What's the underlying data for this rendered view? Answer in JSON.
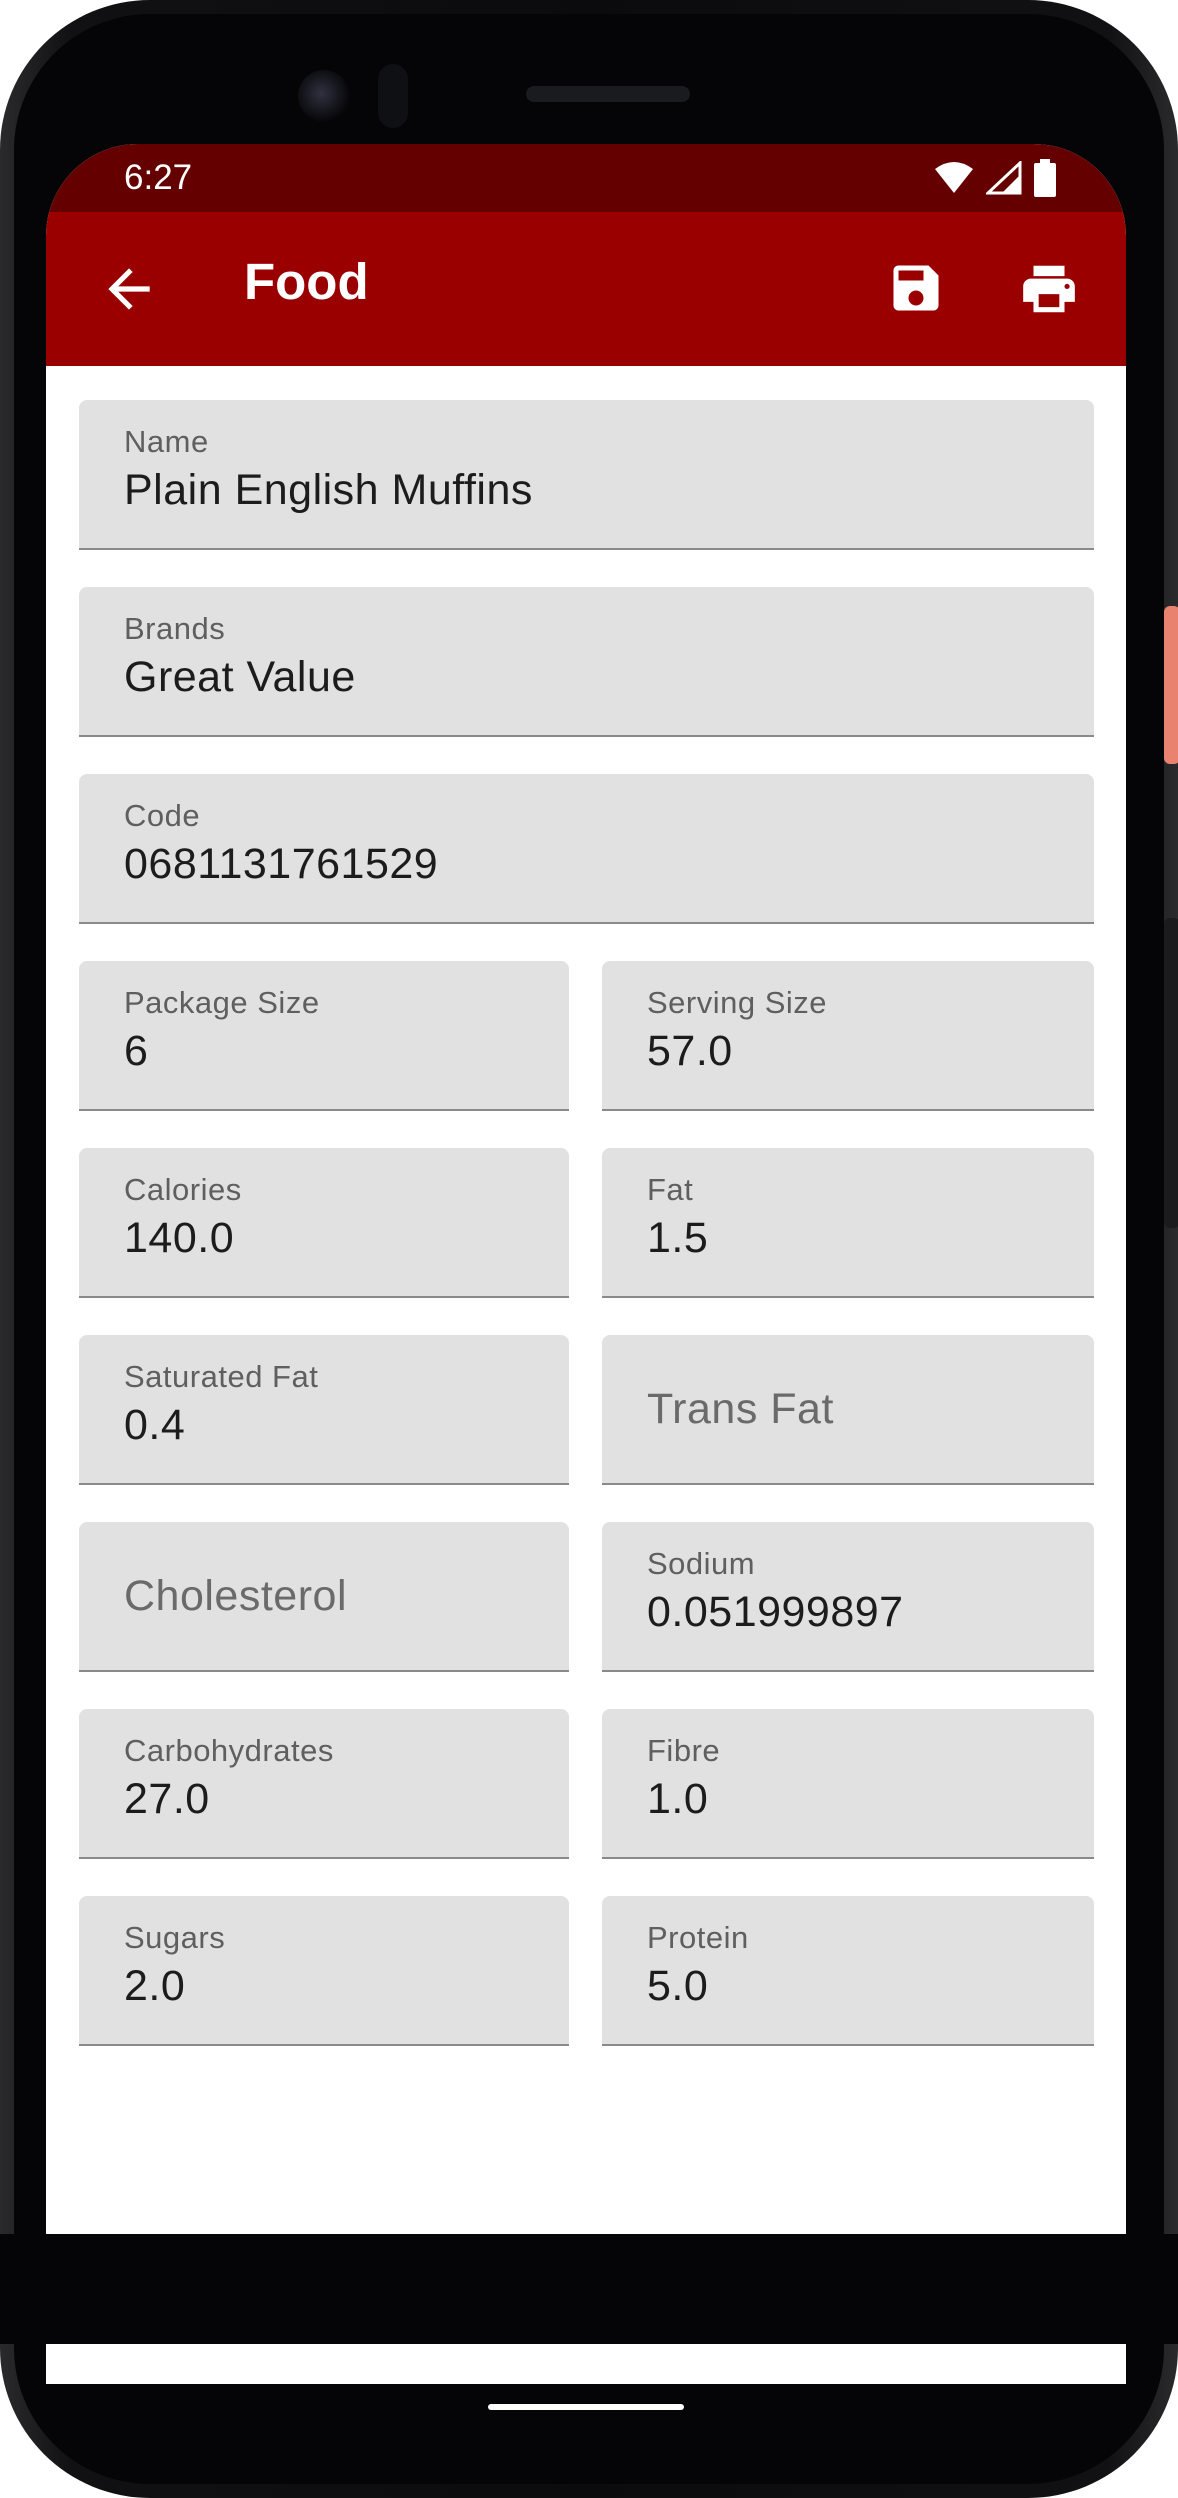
{
  "status_bar": {
    "time": "6:27"
  },
  "app_bar": {
    "title": "Food"
  },
  "fields": [
    {
      "id": "name",
      "label": "Name",
      "value": "Plain English Muffins"
    },
    {
      "id": "brands",
      "label": "Brands",
      "value": "Great Value"
    },
    {
      "id": "code",
      "label": "Code",
      "value": "0681131761529"
    },
    {
      "id": "package_size",
      "label": "Package Size",
      "value": "6"
    },
    {
      "id": "serving_size",
      "label": "Serving Size",
      "value": "57.0"
    },
    {
      "id": "calories",
      "label": "Calories",
      "value": "140.0"
    },
    {
      "id": "fat",
      "label": "Fat",
      "value": "1.5"
    },
    {
      "id": "saturated_fat",
      "label": "Saturated Fat",
      "value": "0.4"
    },
    {
      "id": "trans_fat",
      "label": "Trans Fat",
      "value": ""
    },
    {
      "id": "cholesterol",
      "label": "Cholesterol",
      "value": ""
    },
    {
      "id": "sodium",
      "label": "Sodium",
      "value": "0.051999897"
    },
    {
      "id": "carbohydrates",
      "label": "Carbohydrates",
      "value": "27.0"
    },
    {
      "id": "fibre",
      "label": "Fibre",
      "value": "1.0"
    },
    {
      "id": "sugars",
      "label": "Sugars",
      "value": "2.0"
    },
    {
      "id": "protein",
      "label": "Protein",
      "value": "5.0"
    }
  ],
  "icons": {
    "back": "arrow-back-icon",
    "save": "save-icon",
    "print": "print-icon",
    "wifi": "wifi-icon",
    "signal": "signal-icon",
    "battery": "battery-icon"
  },
  "colors": {
    "app_bar": "#9b0000",
    "status_bar": "#650000",
    "field_bg": "#e1e1e1"
  }
}
